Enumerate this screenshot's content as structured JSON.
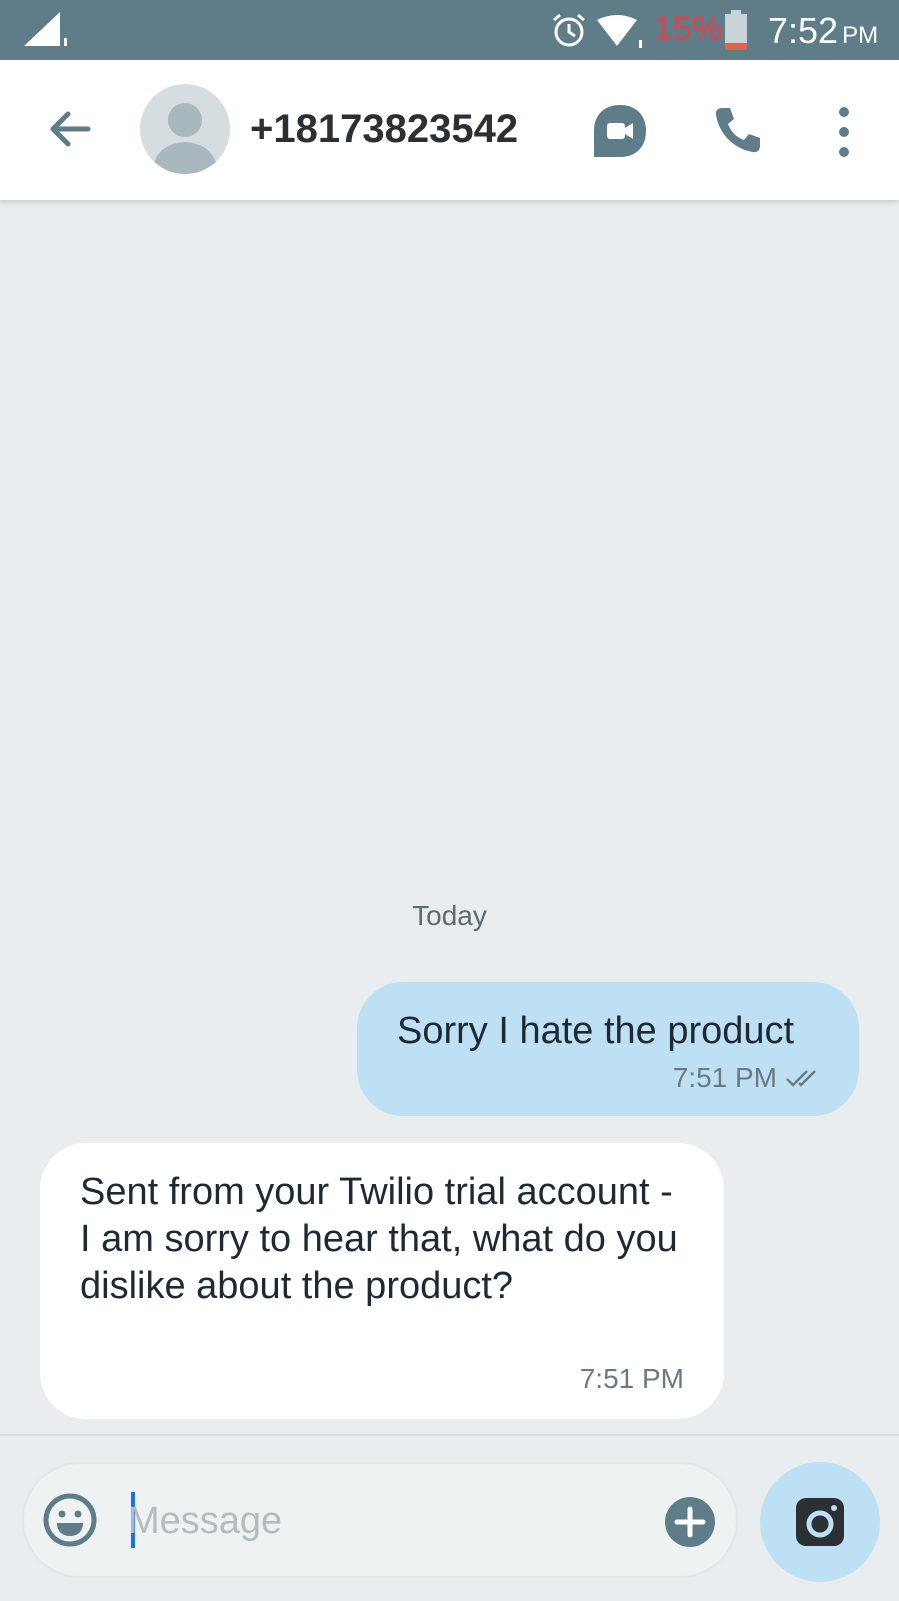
{
  "status_bar": {
    "battery_percent": "15%",
    "time": "7:52",
    "ampm": "PM",
    "battery_color": "#e8404a"
  },
  "header": {
    "contact": "+18173823542",
    "icons": [
      "back-arrow-icon",
      "avatar",
      "video-call-icon",
      "phone-icon",
      "more-vert-icon"
    ]
  },
  "conversation": {
    "date_divider": "Today",
    "messages": [
      {
        "direction": "outgoing",
        "text": "Sorry I hate the product",
        "time": "7:51 PM",
        "status_icon": "double-check-icon"
      },
      {
        "direction": "incoming",
        "text": "Sent from your Twilio trial account - I am sorry to hear that, what do you dislike about the product?",
        "time": "7:51 PM"
      }
    ]
  },
  "composer": {
    "placeholder": "Message",
    "icons": [
      "emoji-icon",
      "add-icon",
      "camera-icon"
    ]
  },
  "colors": {
    "status_bar": "#5f7d89",
    "accent": "#5f7d89",
    "outgoing_bubble": "#bee0f4",
    "incoming_bubble": "#ffffff",
    "background": "#e9edf0"
  }
}
